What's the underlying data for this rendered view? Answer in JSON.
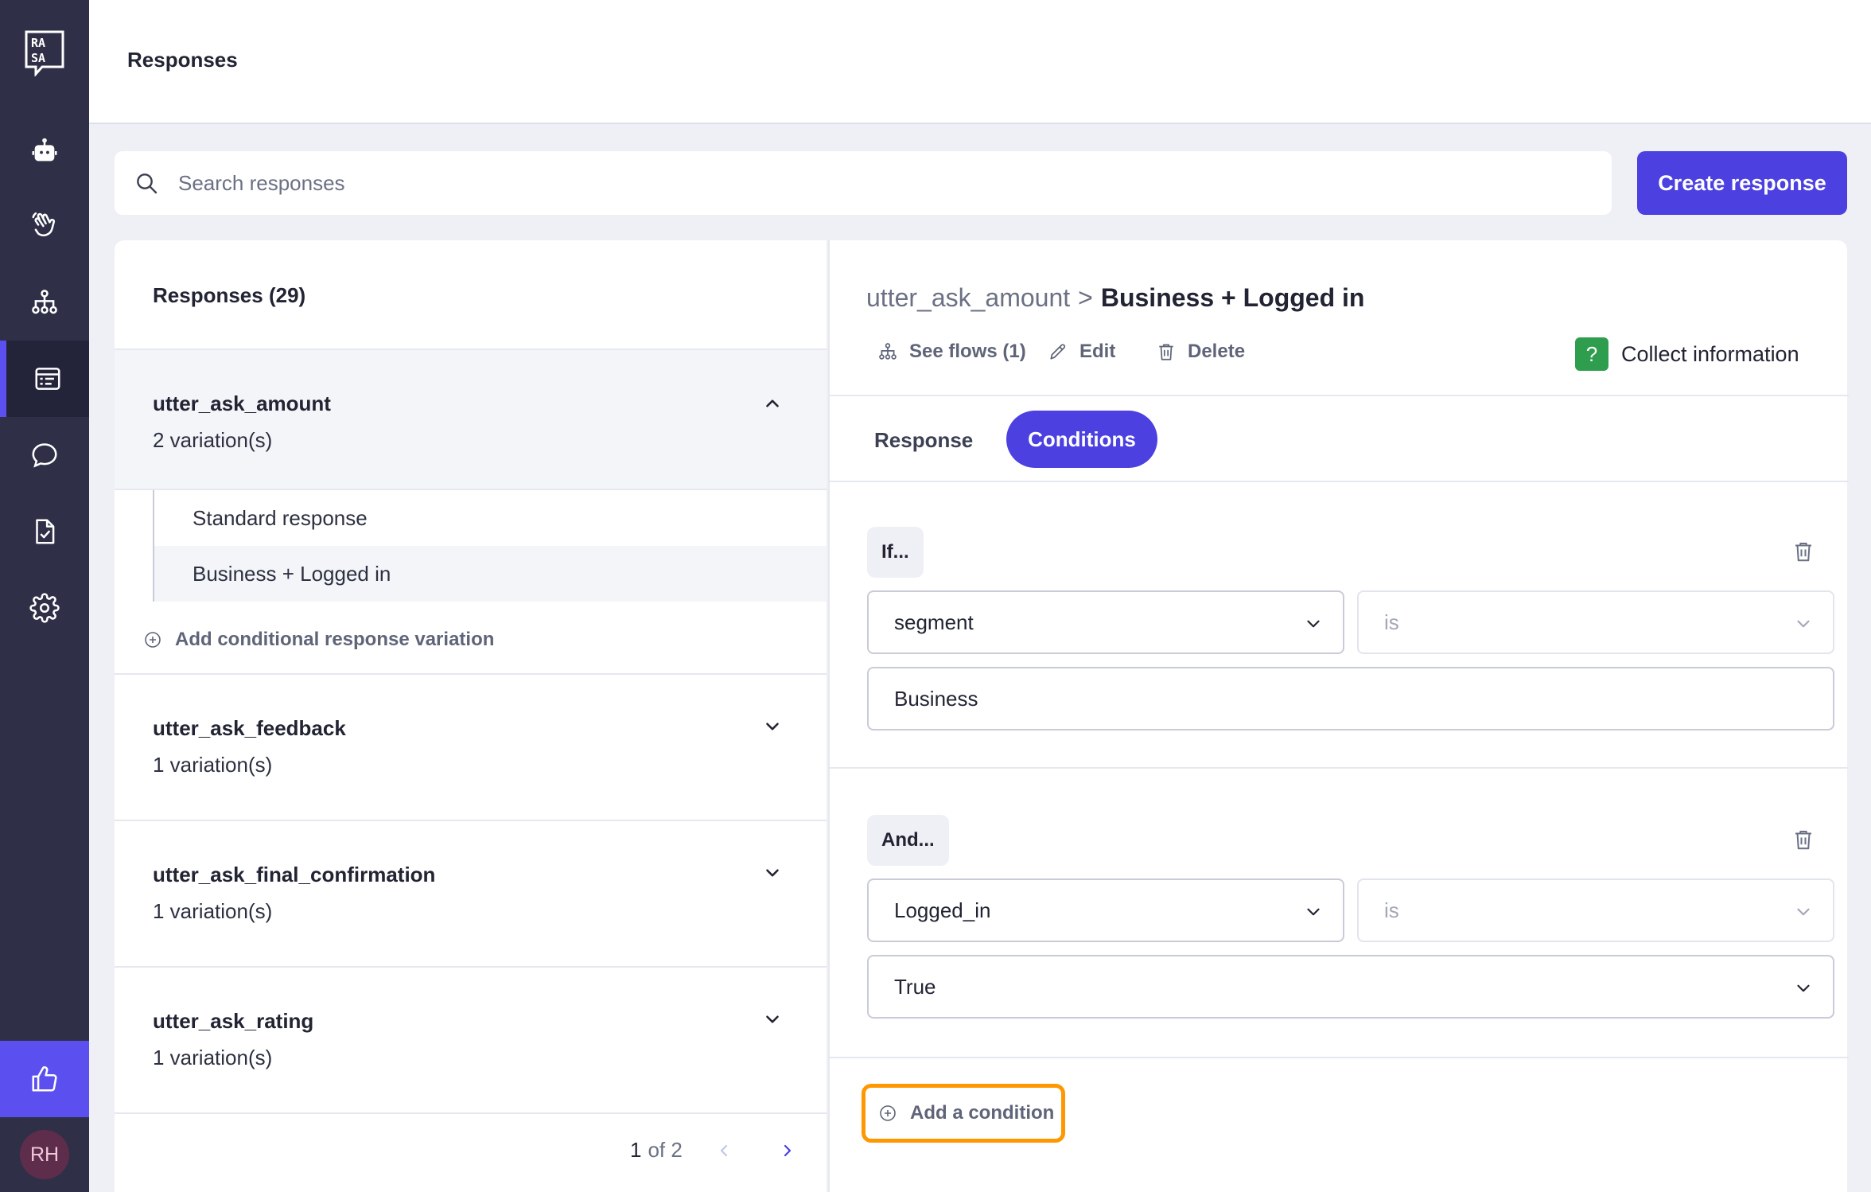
{
  "header": {
    "title": "Responses"
  },
  "sidebar": {
    "logo_icon": "rasa-logo",
    "items": [
      {
        "icon": "robot-icon",
        "active": false
      },
      {
        "icon": "hand-wave-icon",
        "active": false
      },
      {
        "icon": "flows-icon",
        "active": false
      },
      {
        "icon": "responses-icon",
        "active": true
      },
      {
        "icon": "chat-icon",
        "active": false
      },
      {
        "icon": "document-check-icon",
        "active": false
      },
      {
        "icon": "gear-icon",
        "active": false
      }
    ],
    "feedback_icon": "thumbs-up-icon",
    "avatar_initials": "RH"
  },
  "search": {
    "placeholder": "Search responses",
    "value": ""
  },
  "create_button": "Create response",
  "list": {
    "title": "Responses (29)",
    "groups": [
      {
        "name": "utter_ask_amount",
        "count": "2 variation(s)",
        "expanded": true,
        "variations": [
          "Standard response",
          "Business + Logged in"
        ],
        "selected_variation": "Business + Logged in"
      },
      {
        "name": "utter_ask_feedback",
        "count": "1 variation(s)",
        "expanded": false
      },
      {
        "name": "utter_ask_final_confirmation",
        "count": "1 variation(s)",
        "expanded": false
      },
      {
        "name": "utter_ask_rating",
        "count": "1 variation(s)",
        "expanded": false
      }
    ],
    "add_variation": "Add conditional response variation",
    "pagination": {
      "current": "1",
      "of_total": "of 2"
    }
  },
  "detail": {
    "breadcrumb": {
      "parent": "utter_ask_amount",
      "separator": ">",
      "current": "Business + Logged in"
    },
    "actions": {
      "see_flows": "See flows (1)",
      "edit": "Edit",
      "delete": "Delete"
    },
    "collect": {
      "icon_text": "?",
      "label": "Collect information",
      "color": "#2e9d4d"
    },
    "tabs": {
      "response": "Response",
      "conditions": "Conditions",
      "active": "Conditions"
    },
    "conditions": [
      {
        "label": "If...",
        "slot": "segment",
        "operator": "is",
        "value": "Business"
      },
      {
        "label": "And...",
        "slot": "Logged_in",
        "operator": "is",
        "value": "True"
      }
    ],
    "add_condition": "Add a condition"
  },
  "colors": {
    "accent": "#4c40e0",
    "sidebar": "#2f3047",
    "highlight": "#ff9800"
  }
}
